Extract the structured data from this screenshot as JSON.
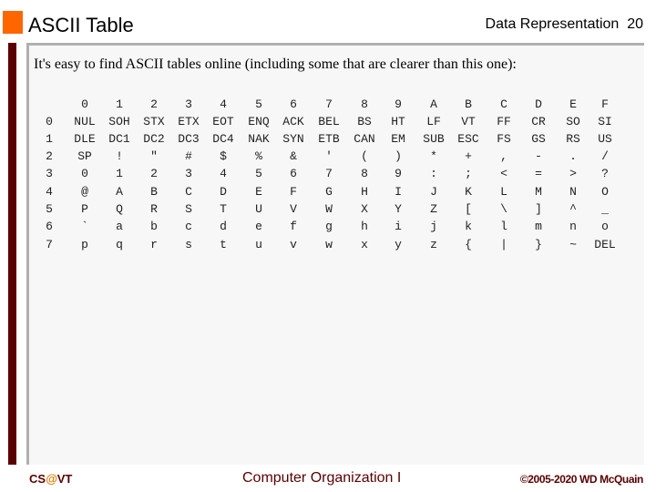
{
  "header": {
    "title": "ASCII Table",
    "section": "Data Representation",
    "page_number": "20",
    "accent_color": "#ff6600",
    "bar_color": "#5a0000"
  },
  "content": {
    "intro": "It's easy to find ASCII tables online (including some that are clearer than this one):",
    "table": {
      "column_headers": [
        "0",
        "1",
        "2",
        "3",
        "4",
        "5",
        "6",
        "7",
        "8",
        "9",
        "A",
        "B",
        "C",
        "D",
        "E",
        "F"
      ],
      "rows": [
        {
          "index": "0",
          "cells": [
            "NUL",
            "SOH",
            "STX",
            "ETX",
            "EOT",
            "ENQ",
            "ACK",
            "BEL",
            "BS",
            "HT",
            "LF",
            "VT",
            "FF",
            "CR",
            "SO",
            "SI"
          ]
        },
        {
          "index": "1",
          "cells": [
            "DLE",
            "DC1",
            "DC2",
            "DC3",
            "DC4",
            "NAK",
            "SYN",
            "ETB",
            "CAN",
            "EM",
            "SUB",
            "ESC",
            "FS",
            "GS",
            "RS",
            "US"
          ]
        },
        {
          "index": "2",
          "cells": [
            "SP",
            "!",
            "\"",
            "#",
            "$",
            "%",
            "&",
            "'",
            "(",
            ")",
            "*",
            "+",
            ",",
            "-",
            ".",
            "/"
          ]
        },
        {
          "index": "3",
          "cells": [
            "0",
            "1",
            "2",
            "3",
            "4",
            "5",
            "6",
            "7",
            "8",
            "9",
            ":",
            ";",
            "<",
            "=",
            ">",
            "?"
          ]
        },
        {
          "index": "4",
          "cells": [
            "@",
            "A",
            "B",
            "C",
            "D",
            "E",
            "F",
            "G",
            "H",
            "I",
            "J",
            "K",
            "L",
            "M",
            "N",
            "O"
          ]
        },
        {
          "index": "5",
          "cells": [
            "P",
            "Q",
            "R",
            "S",
            "T",
            "U",
            "V",
            "W",
            "X",
            "Y",
            "Z",
            "[",
            "\\",
            "]",
            "^",
            "_"
          ]
        },
        {
          "index": "6",
          "cells": [
            "`",
            "a",
            "b",
            "c",
            "d",
            "e",
            "f",
            "g",
            "h",
            "i",
            "j",
            "k",
            "l",
            "m",
            "n",
            "o"
          ]
        },
        {
          "index": "7",
          "cells": [
            "p",
            "q",
            "r",
            "s",
            "t",
            "u",
            "v",
            "w",
            "x",
            "y",
            "z",
            "{",
            "|",
            "}",
            "~",
            "DEL"
          ]
        }
      ]
    }
  },
  "footer": {
    "left_prefix": "CS",
    "left_at": "@",
    "left_suffix": "VT",
    "center": "Computer Organization I",
    "right": "©2005-2020 WD McQuain"
  }
}
